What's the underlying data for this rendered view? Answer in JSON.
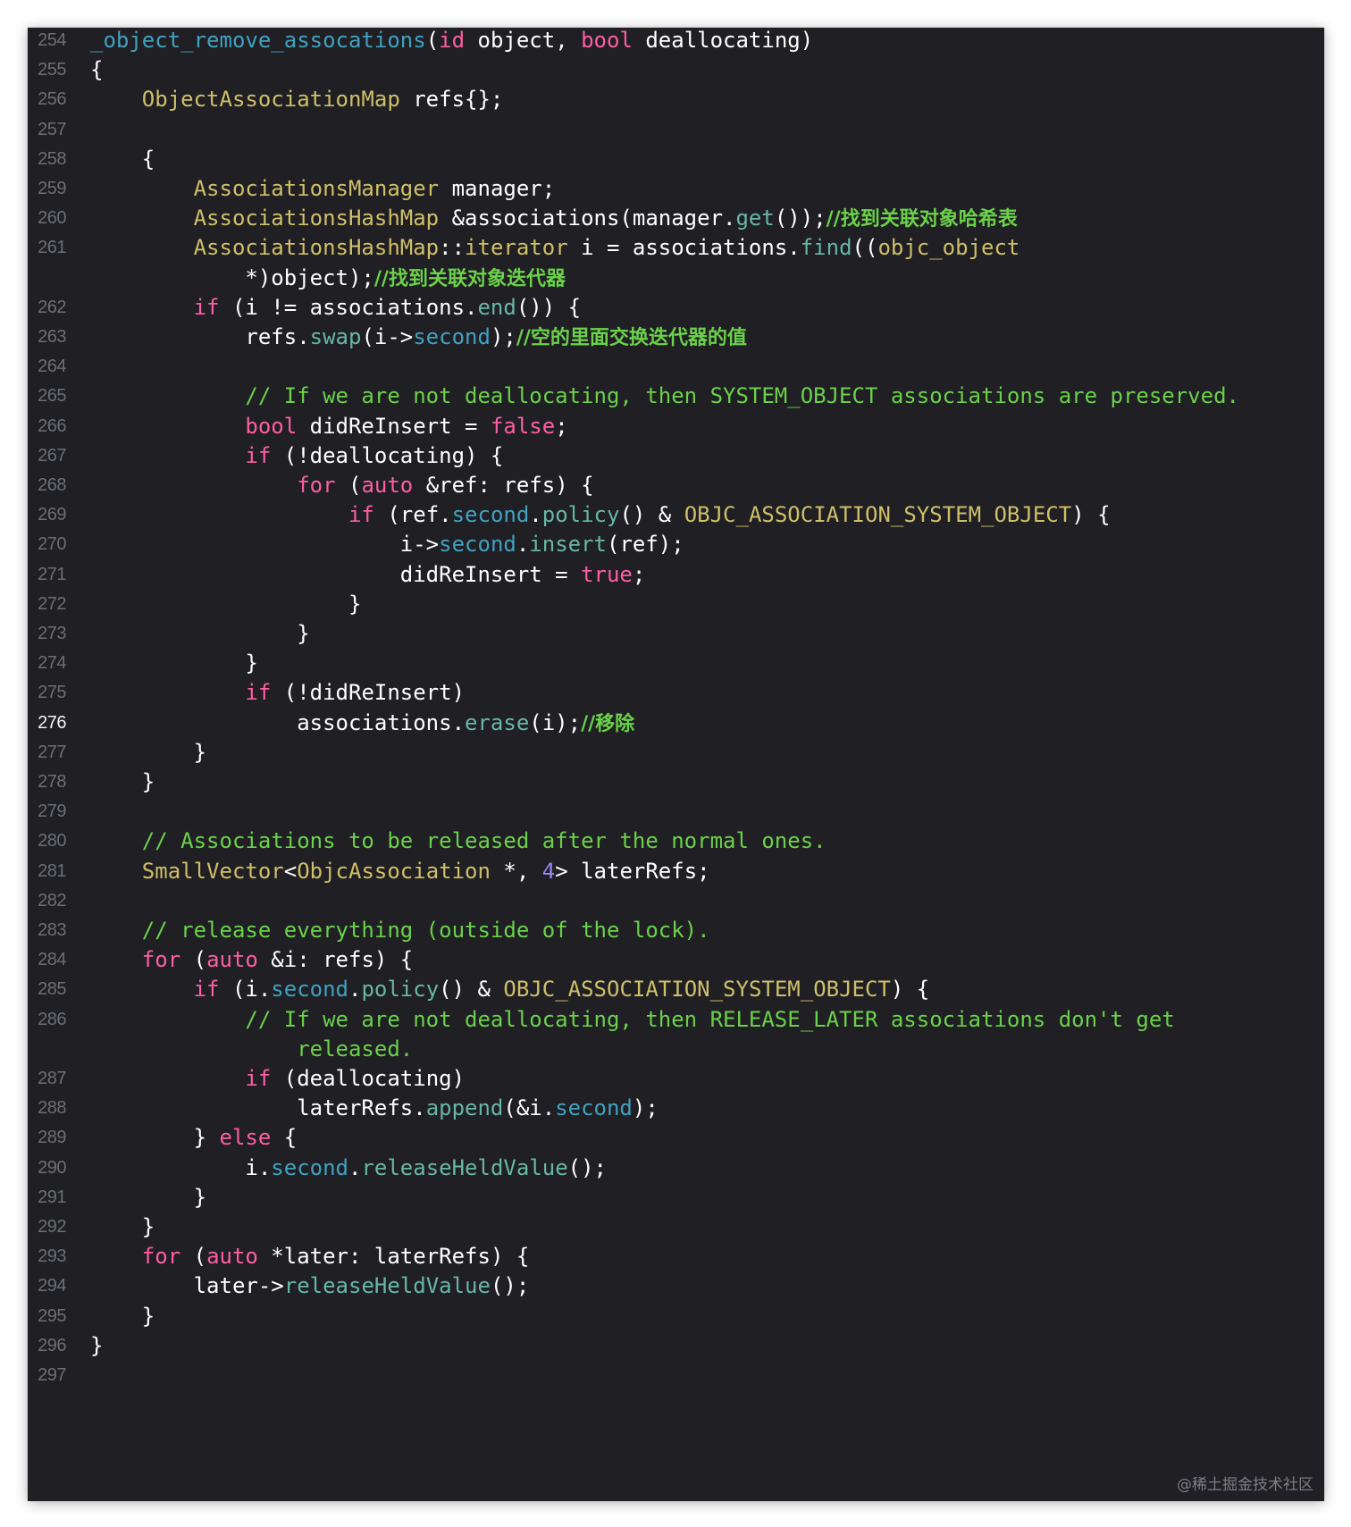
{
  "editor": {
    "current_line": 276,
    "lines": [
      {
        "n": 254,
        "tokens": [
          {
            "t": "_object_remove_assocations",
            "c": "fn2"
          },
          {
            "t": "(",
            "c": ""
          },
          {
            "t": "id",
            "c": "kw"
          },
          {
            "t": " object, ",
            "c": ""
          },
          {
            "t": "bool",
            "c": "kw"
          },
          {
            "t": " deallocating)",
            "c": ""
          }
        ]
      },
      {
        "n": 255,
        "tokens": [
          {
            "t": "{",
            "c": ""
          }
        ]
      },
      {
        "n": 256,
        "tokens": [
          {
            "t": "    ",
            "c": ""
          },
          {
            "t": "ObjectAssociationMap",
            "c": "ty2"
          },
          {
            "t": " refs{};",
            "c": ""
          }
        ]
      },
      {
        "n": 257,
        "tokens": []
      },
      {
        "n": 258,
        "tokens": [
          {
            "t": "    {",
            "c": ""
          }
        ]
      },
      {
        "n": 259,
        "tokens": [
          {
            "t": "        ",
            "c": ""
          },
          {
            "t": "AssociationsManager",
            "c": "ty2"
          },
          {
            "t": " manager;",
            "c": ""
          }
        ]
      },
      {
        "n": 260,
        "tokens": [
          {
            "t": "        ",
            "c": ""
          },
          {
            "t": "AssociationsHashMap",
            "c": "ty2"
          },
          {
            "t": " &associations(manager.",
            "c": ""
          },
          {
            "t": "get",
            "c": "id2"
          },
          {
            "t": "());",
            "c": ""
          },
          {
            "t": "//找到关联对象哈希表",
            "c": "cmz"
          }
        ]
      },
      {
        "n": 261,
        "tokens": [
          {
            "t": "        ",
            "c": ""
          },
          {
            "t": "AssociationsHashMap",
            "c": "ty2"
          },
          {
            "t": "::",
            "c": ""
          },
          {
            "t": "iterator",
            "c": "ty2"
          },
          {
            "t": " i = associations.",
            "c": ""
          },
          {
            "t": "find",
            "c": "id2"
          },
          {
            "t": "((",
            "c": ""
          },
          {
            "t": "objc_object",
            "c": "ty2"
          }
        ]
      },
      {
        "n": null,
        "tokens": [
          {
            "t": "            *)object);",
            "c": ""
          },
          {
            "t": "//找到关联对象迭代器",
            "c": "cmz"
          }
        ]
      },
      {
        "n": 262,
        "tokens": [
          {
            "t": "        ",
            "c": ""
          },
          {
            "t": "if",
            "c": "kw"
          },
          {
            "t": " (i != associations.",
            "c": ""
          },
          {
            "t": "end",
            "c": "id2"
          },
          {
            "t": "()) {",
            "c": ""
          }
        ]
      },
      {
        "n": 263,
        "tokens": [
          {
            "t": "            refs.",
            "c": ""
          },
          {
            "t": "swap",
            "c": "id2"
          },
          {
            "t": "(i->",
            "c": ""
          },
          {
            "t": "second",
            "c": "mem"
          },
          {
            "t": ");",
            "c": ""
          },
          {
            "t": "//空的里面交换迭代器的值",
            "c": "cmz"
          }
        ]
      },
      {
        "n": 264,
        "tokens": []
      },
      {
        "n": 265,
        "tokens": [
          {
            "t": "            ",
            "c": ""
          },
          {
            "t": "// If we are not deallocating, then SYSTEM_OBJECT associations are preserved.",
            "c": "cm"
          }
        ]
      },
      {
        "n": 266,
        "tokens": [
          {
            "t": "            ",
            "c": ""
          },
          {
            "t": "bool",
            "c": "kw"
          },
          {
            "t": " didReInsert = ",
            "c": ""
          },
          {
            "t": "false",
            "c": "lit"
          },
          {
            "t": ";",
            "c": ""
          }
        ]
      },
      {
        "n": 267,
        "tokens": [
          {
            "t": "            ",
            "c": ""
          },
          {
            "t": "if",
            "c": "kw"
          },
          {
            "t": " (!deallocating) {",
            "c": ""
          }
        ]
      },
      {
        "n": 268,
        "tokens": [
          {
            "t": "                ",
            "c": ""
          },
          {
            "t": "for",
            "c": "kw"
          },
          {
            "t": " (",
            "c": ""
          },
          {
            "t": "auto",
            "c": "kw"
          },
          {
            "t": " &ref: refs) {",
            "c": ""
          }
        ]
      },
      {
        "n": 269,
        "tokens": [
          {
            "t": "                    ",
            "c": ""
          },
          {
            "t": "if",
            "c": "kw"
          },
          {
            "t": " (ref.",
            "c": ""
          },
          {
            "t": "second",
            "c": "mem"
          },
          {
            "t": ".",
            "c": ""
          },
          {
            "t": "policy",
            "c": "id2"
          },
          {
            "t": "() & ",
            "c": ""
          },
          {
            "t": "OBJC_ASSOCIATION_SYSTEM_OBJECT",
            "c": "ty2"
          },
          {
            "t": ") {",
            "c": ""
          }
        ]
      },
      {
        "n": 270,
        "tokens": [
          {
            "t": "                        i->",
            "c": ""
          },
          {
            "t": "second",
            "c": "mem"
          },
          {
            "t": ".",
            "c": ""
          },
          {
            "t": "insert",
            "c": "id2"
          },
          {
            "t": "(ref);",
            "c": ""
          }
        ]
      },
      {
        "n": 271,
        "tokens": [
          {
            "t": "                        didReInsert = ",
            "c": ""
          },
          {
            "t": "true",
            "c": "lit"
          },
          {
            "t": ";",
            "c": ""
          }
        ]
      },
      {
        "n": 272,
        "tokens": [
          {
            "t": "                    }",
            "c": ""
          }
        ]
      },
      {
        "n": 273,
        "tokens": [
          {
            "t": "                }",
            "c": ""
          }
        ]
      },
      {
        "n": 274,
        "tokens": [
          {
            "t": "            }",
            "c": ""
          }
        ]
      },
      {
        "n": 275,
        "tokens": [
          {
            "t": "            ",
            "c": ""
          },
          {
            "t": "if",
            "c": "kw"
          },
          {
            "t": " (!didReInsert)",
            "c": ""
          }
        ]
      },
      {
        "n": 276,
        "tokens": [
          {
            "t": "                associations.",
            "c": ""
          },
          {
            "t": "erase",
            "c": "id2"
          },
          {
            "t": "(i);",
            "c": ""
          },
          {
            "t": "//移除",
            "c": "cmz"
          }
        ]
      },
      {
        "n": 277,
        "tokens": [
          {
            "t": "        }",
            "c": ""
          }
        ]
      },
      {
        "n": 278,
        "tokens": [
          {
            "t": "    }",
            "c": ""
          }
        ]
      },
      {
        "n": 279,
        "tokens": []
      },
      {
        "n": 280,
        "tokens": [
          {
            "t": "    ",
            "c": ""
          },
          {
            "t": "// Associations to be released after the normal ones.",
            "c": "cm"
          }
        ]
      },
      {
        "n": 281,
        "tokens": [
          {
            "t": "    ",
            "c": ""
          },
          {
            "t": "SmallVector",
            "c": "ty2"
          },
          {
            "t": "<",
            "c": ""
          },
          {
            "t": "ObjcAssociation",
            "c": "ty2"
          },
          {
            "t": " *, ",
            "c": ""
          },
          {
            "t": "4",
            "c": "nm"
          },
          {
            "t": "> laterRefs;",
            "c": ""
          }
        ]
      },
      {
        "n": 282,
        "tokens": []
      },
      {
        "n": 283,
        "tokens": [
          {
            "t": "    ",
            "c": ""
          },
          {
            "t": "// release everything (outside of the lock).",
            "c": "cm"
          }
        ]
      },
      {
        "n": 284,
        "tokens": [
          {
            "t": "    ",
            "c": ""
          },
          {
            "t": "for",
            "c": "kw"
          },
          {
            "t": " (",
            "c": ""
          },
          {
            "t": "auto",
            "c": "kw"
          },
          {
            "t": " &i: refs) {",
            "c": ""
          }
        ]
      },
      {
        "n": 285,
        "tokens": [
          {
            "t": "        ",
            "c": ""
          },
          {
            "t": "if",
            "c": "kw"
          },
          {
            "t": " (i.",
            "c": ""
          },
          {
            "t": "second",
            "c": "mem"
          },
          {
            "t": ".",
            "c": ""
          },
          {
            "t": "policy",
            "c": "id2"
          },
          {
            "t": "() & ",
            "c": ""
          },
          {
            "t": "OBJC_ASSOCIATION_SYSTEM_OBJECT",
            "c": "ty2"
          },
          {
            "t": ") {",
            "c": ""
          }
        ]
      },
      {
        "n": 286,
        "tokens": [
          {
            "t": "            ",
            "c": ""
          },
          {
            "t": "// If we are not deallocating, then RELEASE_LATER associations don't get",
            "c": "cm"
          }
        ]
      },
      {
        "n": null,
        "tokens": [
          {
            "t": "                ",
            "c": ""
          },
          {
            "t": "released.",
            "c": "cm"
          }
        ]
      },
      {
        "n": 287,
        "tokens": [
          {
            "t": "            ",
            "c": ""
          },
          {
            "t": "if",
            "c": "kw"
          },
          {
            "t": " (deallocating)",
            "c": ""
          }
        ]
      },
      {
        "n": 288,
        "tokens": [
          {
            "t": "                laterRefs.",
            "c": ""
          },
          {
            "t": "append",
            "c": "id2"
          },
          {
            "t": "(&i.",
            "c": ""
          },
          {
            "t": "second",
            "c": "mem"
          },
          {
            "t": ");",
            "c": ""
          }
        ]
      },
      {
        "n": 289,
        "tokens": [
          {
            "t": "        } ",
            "c": ""
          },
          {
            "t": "else",
            "c": "kw"
          },
          {
            "t": " {",
            "c": ""
          }
        ]
      },
      {
        "n": 290,
        "tokens": [
          {
            "t": "            i.",
            "c": ""
          },
          {
            "t": "second",
            "c": "mem"
          },
          {
            "t": ".",
            "c": ""
          },
          {
            "t": "releaseHeldValue",
            "c": "id2"
          },
          {
            "t": "();",
            "c": ""
          }
        ]
      },
      {
        "n": 291,
        "tokens": [
          {
            "t": "        }",
            "c": ""
          }
        ]
      },
      {
        "n": 292,
        "tokens": [
          {
            "t": "    }",
            "c": ""
          }
        ]
      },
      {
        "n": 293,
        "tokens": [
          {
            "t": "    ",
            "c": ""
          },
          {
            "t": "for",
            "c": "kw"
          },
          {
            "t": " (",
            "c": ""
          },
          {
            "t": "auto",
            "c": "kw"
          },
          {
            "t": " *later: laterRefs) {",
            "c": ""
          }
        ]
      },
      {
        "n": 294,
        "tokens": [
          {
            "t": "        later->",
            "c": ""
          },
          {
            "t": "releaseHeldValue",
            "c": "id2"
          },
          {
            "t": "();",
            "c": ""
          }
        ]
      },
      {
        "n": 295,
        "tokens": [
          {
            "t": "    }",
            "c": ""
          }
        ]
      },
      {
        "n": 296,
        "tokens": [
          {
            "t": "}",
            "c": ""
          }
        ]
      },
      {
        "n": 297,
        "tokens": []
      }
    ]
  },
  "watermark": "@稀土掘金技术社区",
  "colors": {
    "background": "#1f1f24",
    "current_line_bg": "#2f3036",
    "keyword": "#fc5fa3",
    "type": "#d0bf69",
    "function": "#67b7a4",
    "declaration": "#41a1c0",
    "comment": "#6bd14a",
    "number": "#9686f5",
    "plain": "#ffffff"
  }
}
